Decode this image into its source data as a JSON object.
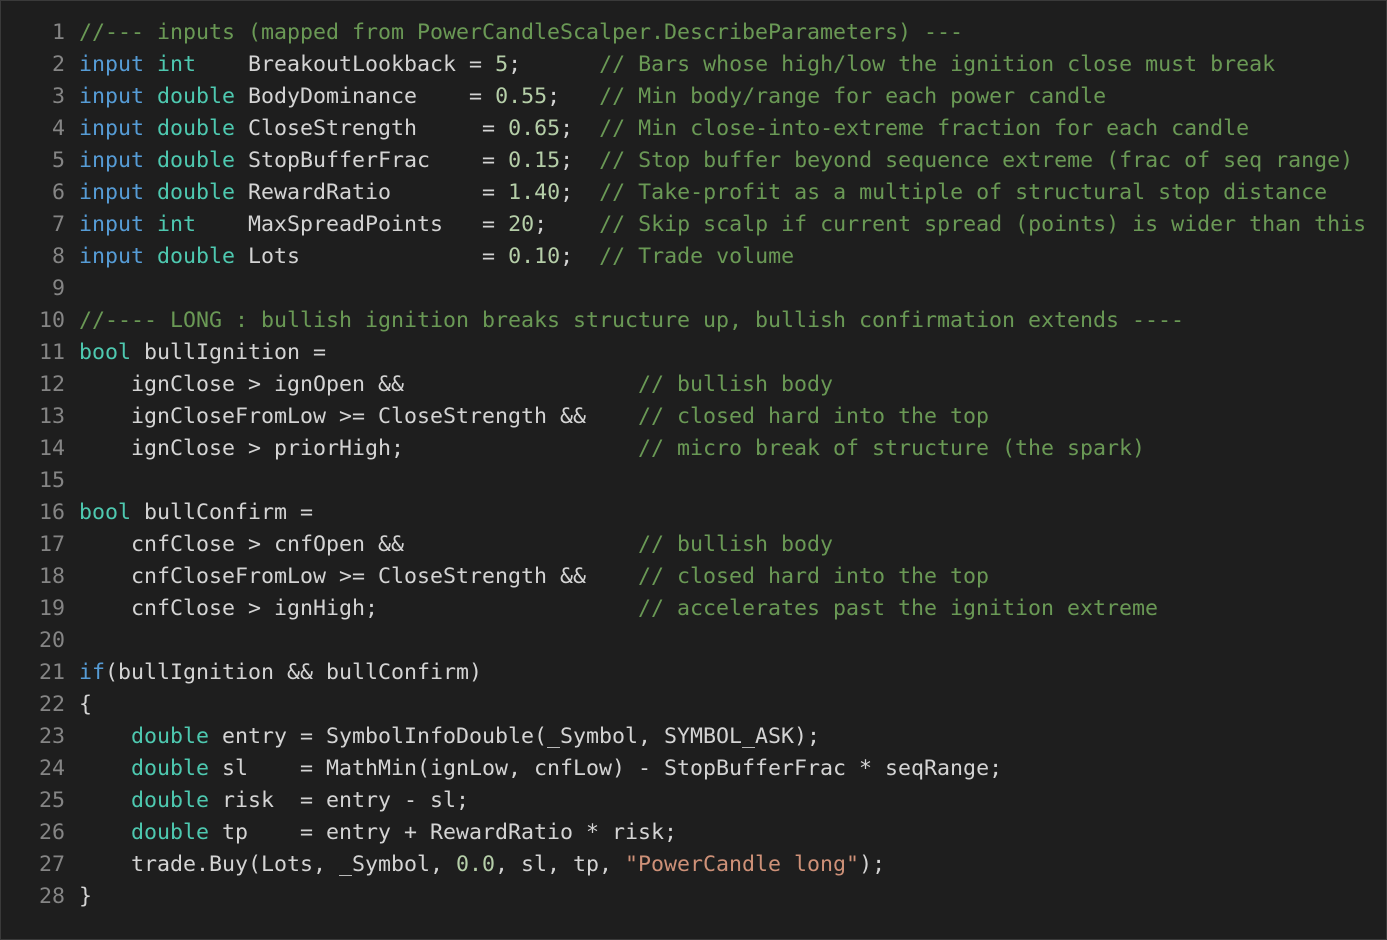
{
  "editor": {
    "colors": {
      "background": "#1e1e1e",
      "default": "#d4d4d4",
      "keyword": "#569cd6",
      "type": "#4ec9b0",
      "number": "#b5cea8",
      "string": "#ce9178",
      "comment": "#6a9955",
      "line_number": "#858585"
    },
    "lines": [
      {
        "n": "1",
        "tokens": [
          [
            "c",
            "//--- inputs (mapped from PowerCandleScalper.DescribeParameters) ---"
          ]
        ]
      },
      {
        "n": "2",
        "tokens": [
          [
            "k",
            "input"
          ],
          [
            "p",
            " "
          ],
          [
            "t",
            "int"
          ],
          [
            "p",
            "    BreakoutLookback = "
          ],
          [
            "n",
            "5"
          ],
          [
            "p",
            ";      "
          ],
          [
            "c",
            "// Bars whose high/low the ignition close must break"
          ]
        ]
      },
      {
        "n": "3",
        "tokens": [
          [
            "k",
            "input"
          ],
          [
            "p",
            " "
          ],
          [
            "t",
            "double"
          ],
          [
            "p",
            " BodyDominance    = "
          ],
          [
            "n",
            "0.55"
          ],
          [
            "p",
            ";   "
          ],
          [
            "c",
            "// Min body/range for each power candle"
          ]
        ]
      },
      {
        "n": "4",
        "tokens": [
          [
            "k",
            "input"
          ],
          [
            "p",
            " "
          ],
          [
            "t",
            "double"
          ],
          [
            "p",
            " CloseStrength     = "
          ],
          [
            "n",
            "0.65"
          ],
          [
            "p",
            ";  "
          ],
          [
            "c",
            "// Min close-into-extreme fraction for each candle"
          ]
        ]
      },
      {
        "n": "5",
        "tokens": [
          [
            "k",
            "input"
          ],
          [
            "p",
            " "
          ],
          [
            "t",
            "double"
          ],
          [
            "p",
            " StopBufferFrac    = "
          ],
          [
            "n",
            "0.15"
          ],
          [
            "p",
            ";  "
          ],
          [
            "c",
            "// Stop buffer beyond sequence extreme (frac of seq range)"
          ]
        ]
      },
      {
        "n": "6",
        "tokens": [
          [
            "k",
            "input"
          ],
          [
            "p",
            " "
          ],
          [
            "t",
            "double"
          ],
          [
            "p",
            " RewardRatio       = "
          ],
          [
            "n",
            "1.40"
          ],
          [
            "p",
            ";  "
          ],
          [
            "c",
            "// Take-profit as a multiple of structural stop distance"
          ]
        ]
      },
      {
        "n": "7",
        "tokens": [
          [
            "k",
            "input"
          ],
          [
            "p",
            " "
          ],
          [
            "t",
            "int"
          ],
          [
            "p",
            "    MaxSpreadPoints   = "
          ],
          [
            "n",
            "20"
          ],
          [
            "p",
            ";    "
          ],
          [
            "c",
            "// Skip scalp if current spread (points) is wider than this"
          ]
        ]
      },
      {
        "n": "8",
        "tokens": [
          [
            "k",
            "input"
          ],
          [
            "p",
            " "
          ],
          [
            "t",
            "double"
          ],
          [
            "p",
            " Lots              = "
          ],
          [
            "n",
            "0.10"
          ],
          [
            "p",
            ";  "
          ],
          [
            "c",
            "// Trade volume"
          ]
        ]
      },
      {
        "n": "9",
        "tokens": []
      },
      {
        "n": "10",
        "tokens": [
          [
            "c",
            "//---- LONG : bullish ignition breaks structure up, bullish confirmation extends ----"
          ]
        ]
      },
      {
        "n": "11",
        "tokens": [
          [
            "t",
            "bool"
          ],
          [
            "p",
            " bullIgnition ="
          ]
        ]
      },
      {
        "n": "12",
        "tokens": [
          [
            "p",
            "    ignClose > ignOpen &&                  "
          ],
          [
            "c",
            "// bullish body"
          ]
        ]
      },
      {
        "n": "13",
        "tokens": [
          [
            "p",
            "    ignCloseFromLow >= CloseStrength &&    "
          ],
          [
            "c",
            "// closed hard into the top"
          ]
        ]
      },
      {
        "n": "14",
        "tokens": [
          [
            "p",
            "    ignClose > priorHigh;                  "
          ],
          [
            "c",
            "// micro break of structure (the spark)"
          ]
        ]
      },
      {
        "n": "15",
        "tokens": []
      },
      {
        "n": "16",
        "tokens": [
          [
            "t",
            "bool"
          ],
          [
            "p",
            " bullConfirm ="
          ]
        ]
      },
      {
        "n": "17",
        "tokens": [
          [
            "p",
            "    cnfClose > cnfOpen &&                  "
          ],
          [
            "c",
            "// bullish body"
          ]
        ]
      },
      {
        "n": "18",
        "tokens": [
          [
            "p",
            "    cnfCloseFromLow >= CloseStrength &&    "
          ],
          [
            "c",
            "// closed hard into the top"
          ]
        ]
      },
      {
        "n": "19",
        "tokens": [
          [
            "p",
            "    cnfClose > ignHigh;                    "
          ],
          [
            "c",
            "// accelerates past the ignition extreme"
          ]
        ]
      },
      {
        "n": "20",
        "tokens": []
      },
      {
        "n": "21",
        "tokens": [
          [
            "k",
            "if"
          ],
          [
            "p",
            "(bullIgnition && bullConfirm)"
          ]
        ]
      },
      {
        "n": "22",
        "tokens": [
          [
            "p",
            "{"
          ]
        ]
      },
      {
        "n": "23",
        "tokens": [
          [
            "p",
            "    "
          ],
          [
            "t",
            "double"
          ],
          [
            "p",
            " entry = SymbolInfoDouble(_Symbol, SYMBOL_ASK);"
          ]
        ]
      },
      {
        "n": "24",
        "tokens": [
          [
            "p",
            "    "
          ],
          [
            "t",
            "double"
          ],
          [
            "p",
            " sl    = MathMin(ignLow, cnfLow) - StopBufferFrac * seqRange;"
          ]
        ]
      },
      {
        "n": "25",
        "tokens": [
          [
            "p",
            "    "
          ],
          [
            "t",
            "double"
          ],
          [
            "p",
            " risk  = entry - sl;"
          ]
        ]
      },
      {
        "n": "26",
        "tokens": [
          [
            "p",
            "    "
          ],
          [
            "t",
            "double"
          ],
          [
            "p",
            " tp    = entry + RewardRatio * risk;"
          ]
        ]
      },
      {
        "n": "27",
        "tokens": [
          [
            "p",
            "    trade.Buy(Lots, _Symbol, "
          ],
          [
            "n",
            "0.0"
          ],
          [
            "p",
            ", sl, tp, "
          ],
          [
            "s",
            "\"PowerCandle long\""
          ],
          [
            "p",
            ");"
          ]
        ]
      },
      {
        "n": "28",
        "tokens": [
          [
            "p",
            "}"
          ]
        ]
      }
    ]
  }
}
